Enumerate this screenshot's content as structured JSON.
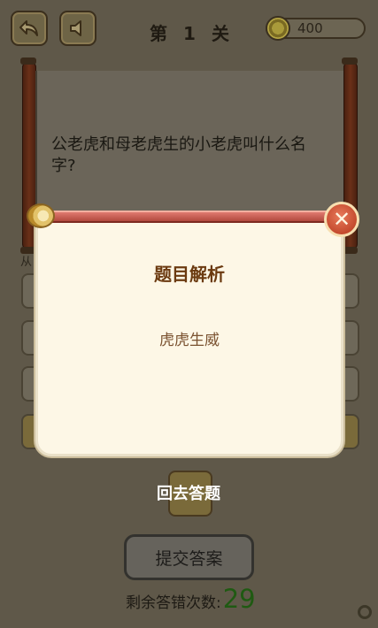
{
  "header": {
    "level_prefix": "第",
    "level_number": "1",
    "level_suffix": "关",
    "coins": "400"
  },
  "question": {
    "text": "公老虎和母老虎生的小老虎叫什么名字?",
    "hint_partial": "从"
  },
  "dialog": {
    "title": "题目解析",
    "answer": "虎虎生威",
    "close_icon": "close-icon"
  },
  "actions": {
    "back_label": "回去答题",
    "submit_label": "提交答案",
    "remaining_label": "剩余答错次数:",
    "remaining_count": "29"
  }
}
